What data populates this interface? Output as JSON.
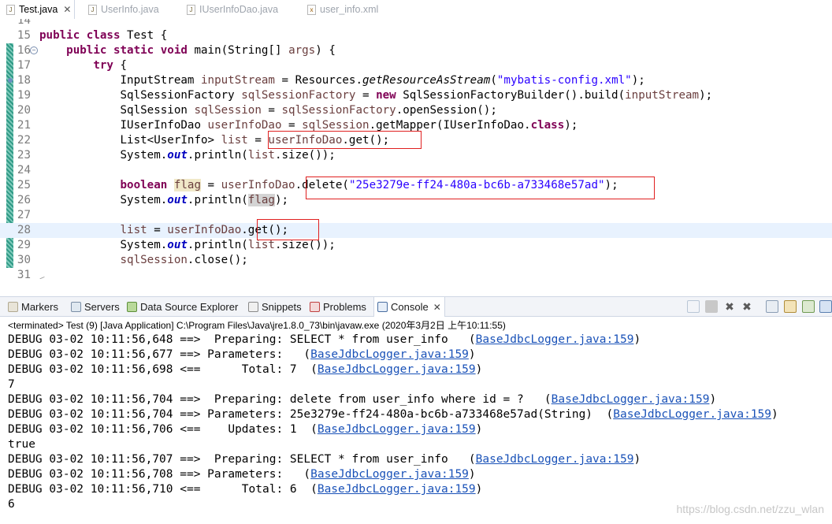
{
  "editor_tabs": [
    {
      "icon": "java-file-icon",
      "label": "Test.java",
      "active": true
    },
    {
      "icon": "java-file-icon",
      "label": "UserInfo.java",
      "active": false
    },
    {
      "icon": "java-file-icon",
      "label": "IUserInfoDao.java",
      "active": false
    },
    {
      "icon": "xml-file-icon",
      "label": "user_info.xml",
      "active": false
    }
  ],
  "editor": {
    "lines": [
      {
        "n": "14",
        "code": [
          {
            "t": ""
          }
        ]
      },
      {
        "n": "15",
        "code": [
          {
            "t": "public",
            "c": "k"
          },
          {
            "t": " "
          },
          {
            "t": "class",
            "c": "k"
          },
          {
            "t": " Test {"
          }
        ]
      },
      {
        "n": "16",
        "code": [
          {
            "t": "    "
          },
          {
            "t": "public",
            "c": "k"
          },
          {
            "t": " "
          },
          {
            "t": "static",
            "c": "k"
          },
          {
            "t": " "
          },
          {
            "t": "void",
            "c": "k"
          },
          {
            "t": " main(String[] "
          },
          {
            "t": "args",
            "c": "f"
          },
          {
            "t": ") {"
          }
        ]
      },
      {
        "n": "17",
        "code": [
          {
            "t": "        "
          },
          {
            "t": "try",
            "c": "k"
          },
          {
            "t": " {"
          }
        ]
      },
      {
        "n": "18",
        "code": [
          {
            "t": "            InputStream "
          },
          {
            "t": "inputStream",
            "c": "f"
          },
          {
            "t": " = Resources."
          },
          {
            "t": "getResourceAsStream",
            "c": "it"
          },
          {
            "t": "("
          },
          {
            "t": "\"mybatis-config.xml\"",
            "c": "s"
          },
          {
            "t": ");"
          }
        ]
      },
      {
        "n": "19",
        "code": [
          {
            "t": "            SqlSessionFactory "
          },
          {
            "t": "sqlSessionFactory",
            "c": "f"
          },
          {
            "t": " = "
          },
          {
            "t": "new",
            "c": "k"
          },
          {
            "t": " SqlSessionFactoryBuilder().build("
          },
          {
            "t": "inputStream",
            "c": "f"
          },
          {
            "t": ");"
          }
        ]
      },
      {
        "n": "20",
        "code": [
          {
            "t": "            SqlSession "
          },
          {
            "t": "sqlSession",
            "c": "f"
          },
          {
            "t": " = "
          },
          {
            "t": "sqlSessionFactory",
            "c": "f"
          },
          {
            "t": ".openSession();"
          }
        ]
      },
      {
        "n": "21",
        "code": [
          {
            "t": "            IUserInfoDao "
          },
          {
            "t": "userInfoDao",
            "c": "f"
          },
          {
            "t": " = "
          },
          {
            "t": "sqlSession",
            "c": "f"
          },
          {
            "t": ".getMapper(IUserInfoDao."
          },
          {
            "t": "class",
            "c": "k"
          },
          {
            "t": ");"
          }
        ]
      },
      {
        "n": "22",
        "code": [
          {
            "t": "            List<UserInfo> "
          },
          {
            "t": "list",
            "c": "f"
          },
          {
            "t": " = "
          },
          {
            "t": "userInfoDao",
            "c": "f"
          },
          {
            "t": ".get();"
          }
        ]
      },
      {
        "n": "23",
        "code": [
          {
            "t": "            System."
          },
          {
            "t": "out",
            "c": "sf"
          },
          {
            "t": ".println("
          },
          {
            "t": "list",
            "c": "f"
          },
          {
            "t": ".size());"
          }
        ]
      },
      {
        "n": "24",
        "code": [
          {
            "t": ""
          }
        ]
      },
      {
        "n": "25",
        "code": [
          {
            "t": "            "
          },
          {
            "t": "boolean",
            "c": "k"
          },
          {
            "t": " "
          },
          {
            "t": "flag",
            "c": "f occ"
          },
          {
            "t": " = "
          },
          {
            "t": "userInfoDao",
            "c": "f"
          },
          {
            "t": ".delete("
          },
          {
            "t": "\"25e3279e-ff24-480a-bc6b-a733468e57ad\"",
            "c": "s"
          },
          {
            "t": ");"
          }
        ]
      },
      {
        "n": "26",
        "code": [
          {
            "t": "            System."
          },
          {
            "t": "out",
            "c": "sf"
          },
          {
            "t": ".println("
          },
          {
            "t": "flag",
            "c": "f occ2"
          },
          {
            "t": ");"
          }
        ]
      },
      {
        "n": "27",
        "code": [
          {
            "t": ""
          }
        ]
      },
      {
        "n": "28",
        "code": [
          {
            "t": "            "
          },
          {
            "t": "list",
            "c": "f"
          },
          {
            "t": " = "
          },
          {
            "t": "userInfoDao",
            "c": "f"
          },
          {
            "t": ".get();"
          }
        ],
        "current": true
      },
      {
        "n": "29",
        "code": [
          {
            "t": "            System."
          },
          {
            "t": "out",
            "c": "sf"
          },
          {
            "t": ".println("
          },
          {
            "t": "list",
            "c": "f"
          },
          {
            "t": ".size());"
          }
        ]
      },
      {
        "n": "30",
        "code": [
          {
            "t": "            "
          },
          {
            "t": "sqlSession",
            "c": "f"
          },
          {
            "t": ".close();"
          }
        ]
      },
      {
        "n": "31",
        "code": [
          {
            "t": ""
          }
        ]
      }
    ]
  },
  "view_tabs": [
    {
      "icon": "markers-icon",
      "label": "Markers"
    },
    {
      "icon": "servers-icon",
      "label": "Servers"
    },
    {
      "icon": "data-source-explorer-icon",
      "label": "Data Source Explorer"
    },
    {
      "icon": "snippets-icon",
      "label": "Snippets"
    },
    {
      "icon": "problems-icon",
      "label": "Problems"
    },
    {
      "icon": "console-icon",
      "label": "Console",
      "active": true
    }
  ],
  "console": {
    "status": "<terminated> Test (9) [Java Application] C:\\Program Files\\Java\\jre1.8.0_73\\bin\\javaw.exe (2020年3月2日 上午10:11:55)",
    "lines": [
      {
        "text": "DEBUG 03-02 10:11:56,648 ==>  Preparing: SELECT * from user_info   ",
        "link": "BaseJdbcLogger.java:159",
        "suffix": ")",
        "pre": "("
      },
      {
        "text": "DEBUG 03-02 10:11:56,677 ==> Parameters:   ",
        "link": "BaseJdbcLogger.java:159",
        "suffix": ")",
        "pre": "("
      },
      {
        "text": "DEBUG 03-02 10:11:56,698 <==      Total: 7  ",
        "link": "BaseJdbcLogger.java:159",
        "suffix": ")",
        "pre": "("
      },
      {
        "text": "7"
      },
      {
        "text": "DEBUG 03-02 10:11:56,704 ==>  Preparing: delete from user_info where id = ?   ",
        "link": "BaseJdbcLogger.java:159",
        "suffix": ")",
        "pre": "("
      },
      {
        "text": "DEBUG 03-02 10:11:56,704 ==> Parameters: 25e3279e-ff24-480a-bc6b-a733468e57ad(String)  ",
        "link": "BaseJdbcLogger.java:159",
        "suffix": ")",
        "pre": "("
      },
      {
        "text": "DEBUG 03-02 10:11:56,706 <==    Updates: 1  ",
        "link": "BaseJdbcLogger.java:159",
        "suffix": ")",
        "pre": "("
      },
      {
        "text": "true"
      },
      {
        "text": "DEBUG 03-02 10:11:56,707 ==>  Preparing: SELECT * from user_info   ",
        "link": "BaseJdbcLogger.java:159",
        "suffix": ")",
        "pre": "("
      },
      {
        "text": "DEBUG 03-02 10:11:56,708 ==> Parameters:   ",
        "link": "BaseJdbcLogger.java:159",
        "suffix": ")",
        "pre": "("
      },
      {
        "text": "DEBUG 03-02 10:11:56,710 <==      Total: 6  ",
        "link": "BaseJdbcLogger.java:159",
        "suffix": ")",
        "pre": "("
      },
      {
        "text": "6"
      }
    ]
  },
  "watermark": "https://blog.csdn.net/zzu_wlan"
}
